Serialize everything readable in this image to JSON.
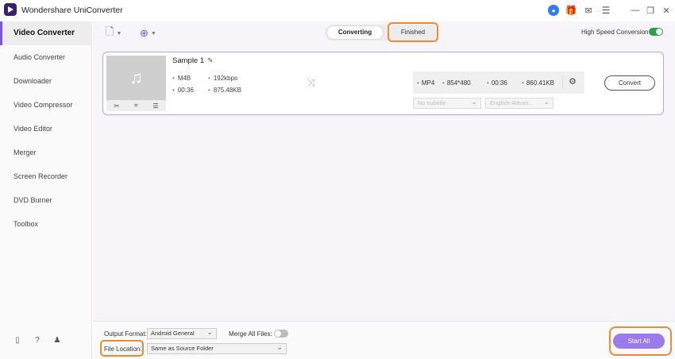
{
  "app": {
    "title": "Wondershare UniConverter"
  },
  "titlebar": {
    "icons": {
      "user": "user-icon",
      "gift": "gift-icon",
      "mail": "mail-icon",
      "menu": "menu-icon",
      "minimize": "minimize-icon",
      "maximize": "maximize-icon",
      "close": "close-icon"
    }
  },
  "sidebar": {
    "items": [
      {
        "label": "Video Converter",
        "active": true
      },
      {
        "label": "Audio Converter"
      },
      {
        "label": "Downloader"
      },
      {
        "label": "Video Compressor"
      },
      {
        "label": "Video Editor"
      },
      {
        "label": "Merger"
      },
      {
        "label": "Screen Recorder"
      },
      {
        "label": "DVD Burner"
      },
      {
        "label": "Toolbox"
      }
    ],
    "footer_icons": [
      "book-icon",
      "help-icon",
      "account-icon"
    ]
  },
  "tabs": {
    "converting": "Converting",
    "finished": "Finished"
  },
  "high_speed": {
    "label": "High Speed Conversion",
    "enabled": true
  },
  "file": {
    "name": "Sample 1",
    "source": {
      "format": "M4B",
      "duration": "00:36",
      "bitrate": "192kbps",
      "size": "875.48KB"
    },
    "output": {
      "format": "MP4",
      "resolution": "854*480",
      "duration": "00:36",
      "size": "860.41KB"
    },
    "subtitle_placeholder": "No subtitle",
    "audio_track": "English-Advan...",
    "convert_label": "Convert"
  },
  "bottom": {
    "output_format_label": "Output Format:",
    "output_format_value": "Android General",
    "merge_label": "Merge All Files:",
    "merge_enabled": false,
    "file_location_label": "File Location:",
    "file_location_value": "Same as Source Folder",
    "start_all_label": "Start All"
  },
  "colors": {
    "accent": "#7b56e0",
    "highlight": "#ef8a3a",
    "toggle_on": "#2f9d4e",
    "start_button": "#9b7bea"
  }
}
